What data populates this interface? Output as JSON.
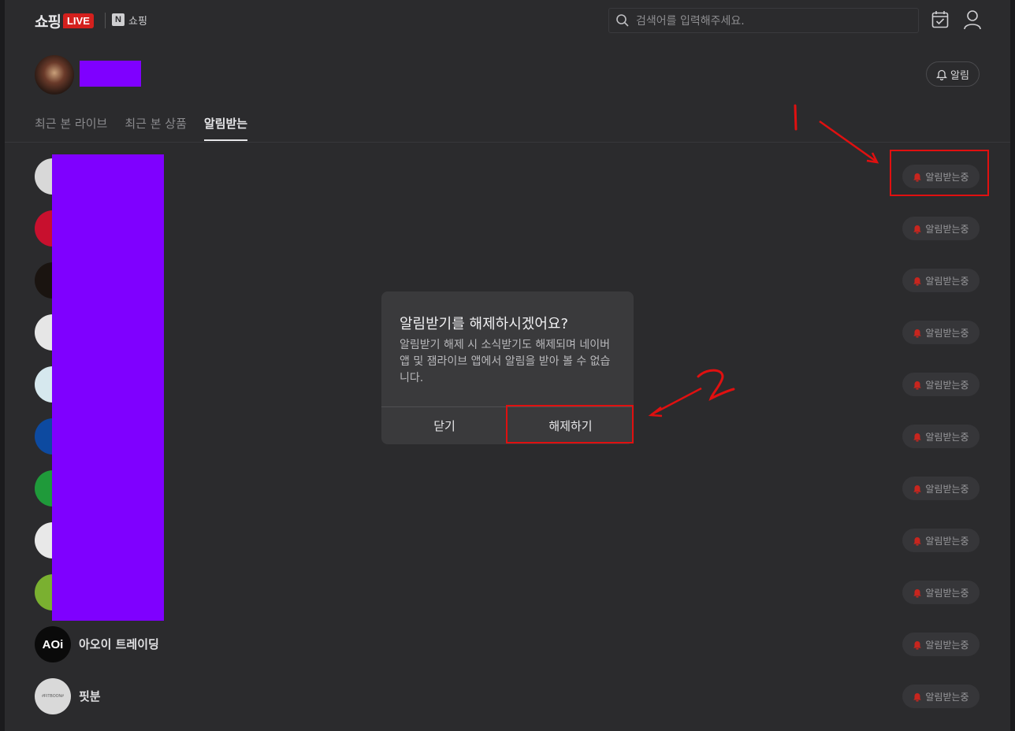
{
  "header": {
    "logo_text": "쇼핑",
    "live_badge": "LIVE",
    "n_badge": "N",
    "n_label": "쇼핑",
    "search_placeholder": "검색어를 입력해주세요."
  },
  "profile": {
    "notify_label": "알림"
  },
  "tabs": [
    {
      "label": "최근 본 라이브",
      "active": false
    },
    {
      "label": "최근 본 상품",
      "active": false
    },
    {
      "label": "알림받는",
      "active": true
    }
  ],
  "subscriptions": {
    "status_label": "알림받는중",
    "items": [
      {
        "name": ""
      },
      {
        "name": ""
      },
      {
        "name": ""
      },
      {
        "name": ""
      },
      {
        "name": ""
      },
      {
        "name": ""
      },
      {
        "name": ""
      },
      {
        "name": ""
      },
      {
        "name": ""
      },
      {
        "name": "아오이 트레이딩",
        "avatar_text": "AOi"
      },
      {
        "name": "핏분",
        "avatar_text": "#FITBOON#"
      }
    ]
  },
  "modal": {
    "title": "알림받기를 해제하시겠어요?",
    "body": "알림받기 해제 시 소식받기도 해제되며 네이버 앱 및 잼라이브 앱에서 알림을 받아 볼 수 없습니다.",
    "close_label": "닫기",
    "confirm_label": "해제하기"
  },
  "colors": {
    "accent_red": "#d4201d",
    "background": "#2b2b2d",
    "annotation_red": "#e01010",
    "redaction": "#7f00ff"
  }
}
